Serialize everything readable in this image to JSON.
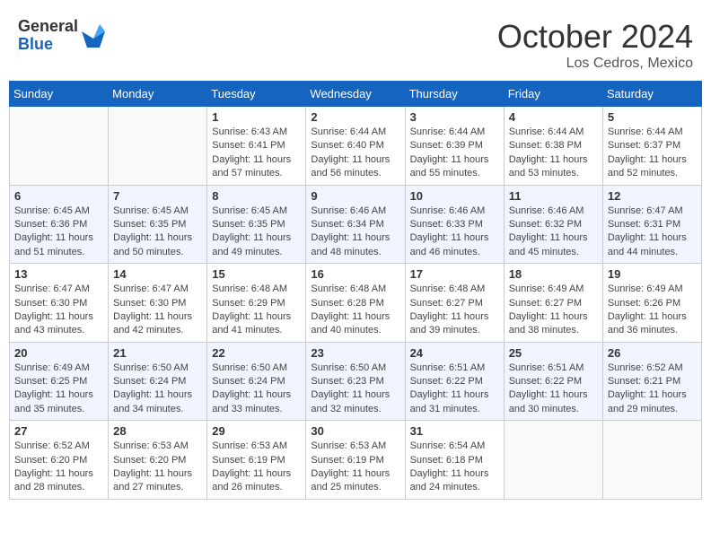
{
  "header": {
    "logo_general": "General",
    "logo_blue": "Blue",
    "month_title": "October 2024",
    "location": "Los Cedros, Mexico"
  },
  "weekdays": [
    "Sunday",
    "Monday",
    "Tuesday",
    "Wednesday",
    "Thursday",
    "Friday",
    "Saturday"
  ],
  "weeks": [
    [
      {
        "day": "",
        "sunrise": "",
        "sunset": "",
        "daylight": ""
      },
      {
        "day": "",
        "sunrise": "",
        "sunset": "",
        "daylight": ""
      },
      {
        "day": "1",
        "sunrise": "Sunrise: 6:43 AM",
        "sunset": "Sunset: 6:41 PM",
        "daylight": "Daylight: 11 hours and 57 minutes."
      },
      {
        "day": "2",
        "sunrise": "Sunrise: 6:44 AM",
        "sunset": "Sunset: 6:40 PM",
        "daylight": "Daylight: 11 hours and 56 minutes."
      },
      {
        "day": "3",
        "sunrise": "Sunrise: 6:44 AM",
        "sunset": "Sunset: 6:39 PM",
        "daylight": "Daylight: 11 hours and 55 minutes."
      },
      {
        "day": "4",
        "sunrise": "Sunrise: 6:44 AM",
        "sunset": "Sunset: 6:38 PM",
        "daylight": "Daylight: 11 hours and 53 minutes."
      },
      {
        "day": "5",
        "sunrise": "Sunrise: 6:44 AM",
        "sunset": "Sunset: 6:37 PM",
        "daylight": "Daylight: 11 hours and 52 minutes."
      }
    ],
    [
      {
        "day": "6",
        "sunrise": "Sunrise: 6:45 AM",
        "sunset": "Sunset: 6:36 PM",
        "daylight": "Daylight: 11 hours and 51 minutes."
      },
      {
        "day": "7",
        "sunrise": "Sunrise: 6:45 AM",
        "sunset": "Sunset: 6:35 PM",
        "daylight": "Daylight: 11 hours and 50 minutes."
      },
      {
        "day": "8",
        "sunrise": "Sunrise: 6:45 AM",
        "sunset": "Sunset: 6:35 PM",
        "daylight": "Daylight: 11 hours and 49 minutes."
      },
      {
        "day": "9",
        "sunrise": "Sunrise: 6:46 AM",
        "sunset": "Sunset: 6:34 PM",
        "daylight": "Daylight: 11 hours and 48 minutes."
      },
      {
        "day": "10",
        "sunrise": "Sunrise: 6:46 AM",
        "sunset": "Sunset: 6:33 PM",
        "daylight": "Daylight: 11 hours and 46 minutes."
      },
      {
        "day": "11",
        "sunrise": "Sunrise: 6:46 AM",
        "sunset": "Sunset: 6:32 PM",
        "daylight": "Daylight: 11 hours and 45 minutes."
      },
      {
        "day": "12",
        "sunrise": "Sunrise: 6:47 AM",
        "sunset": "Sunset: 6:31 PM",
        "daylight": "Daylight: 11 hours and 44 minutes."
      }
    ],
    [
      {
        "day": "13",
        "sunrise": "Sunrise: 6:47 AM",
        "sunset": "Sunset: 6:30 PM",
        "daylight": "Daylight: 11 hours and 43 minutes."
      },
      {
        "day": "14",
        "sunrise": "Sunrise: 6:47 AM",
        "sunset": "Sunset: 6:30 PM",
        "daylight": "Daylight: 11 hours and 42 minutes."
      },
      {
        "day": "15",
        "sunrise": "Sunrise: 6:48 AM",
        "sunset": "Sunset: 6:29 PM",
        "daylight": "Daylight: 11 hours and 41 minutes."
      },
      {
        "day": "16",
        "sunrise": "Sunrise: 6:48 AM",
        "sunset": "Sunset: 6:28 PM",
        "daylight": "Daylight: 11 hours and 40 minutes."
      },
      {
        "day": "17",
        "sunrise": "Sunrise: 6:48 AM",
        "sunset": "Sunset: 6:27 PM",
        "daylight": "Daylight: 11 hours and 39 minutes."
      },
      {
        "day": "18",
        "sunrise": "Sunrise: 6:49 AM",
        "sunset": "Sunset: 6:27 PM",
        "daylight": "Daylight: 11 hours and 38 minutes."
      },
      {
        "day": "19",
        "sunrise": "Sunrise: 6:49 AM",
        "sunset": "Sunset: 6:26 PM",
        "daylight": "Daylight: 11 hours and 36 minutes."
      }
    ],
    [
      {
        "day": "20",
        "sunrise": "Sunrise: 6:49 AM",
        "sunset": "Sunset: 6:25 PM",
        "daylight": "Daylight: 11 hours and 35 minutes."
      },
      {
        "day": "21",
        "sunrise": "Sunrise: 6:50 AM",
        "sunset": "Sunset: 6:24 PM",
        "daylight": "Daylight: 11 hours and 34 minutes."
      },
      {
        "day": "22",
        "sunrise": "Sunrise: 6:50 AM",
        "sunset": "Sunset: 6:24 PM",
        "daylight": "Daylight: 11 hours and 33 minutes."
      },
      {
        "day": "23",
        "sunrise": "Sunrise: 6:50 AM",
        "sunset": "Sunset: 6:23 PM",
        "daylight": "Daylight: 11 hours and 32 minutes."
      },
      {
        "day": "24",
        "sunrise": "Sunrise: 6:51 AM",
        "sunset": "Sunset: 6:22 PM",
        "daylight": "Daylight: 11 hours and 31 minutes."
      },
      {
        "day": "25",
        "sunrise": "Sunrise: 6:51 AM",
        "sunset": "Sunset: 6:22 PM",
        "daylight": "Daylight: 11 hours and 30 minutes."
      },
      {
        "day": "26",
        "sunrise": "Sunrise: 6:52 AM",
        "sunset": "Sunset: 6:21 PM",
        "daylight": "Daylight: 11 hours and 29 minutes."
      }
    ],
    [
      {
        "day": "27",
        "sunrise": "Sunrise: 6:52 AM",
        "sunset": "Sunset: 6:20 PM",
        "daylight": "Daylight: 11 hours and 28 minutes."
      },
      {
        "day": "28",
        "sunrise": "Sunrise: 6:53 AM",
        "sunset": "Sunset: 6:20 PM",
        "daylight": "Daylight: 11 hours and 27 minutes."
      },
      {
        "day": "29",
        "sunrise": "Sunrise: 6:53 AM",
        "sunset": "Sunset: 6:19 PM",
        "daylight": "Daylight: 11 hours and 26 minutes."
      },
      {
        "day": "30",
        "sunrise": "Sunrise: 6:53 AM",
        "sunset": "Sunset: 6:19 PM",
        "daylight": "Daylight: 11 hours and 25 minutes."
      },
      {
        "day": "31",
        "sunrise": "Sunrise: 6:54 AM",
        "sunset": "Sunset: 6:18 PM",
        "daylight": "Daylight: 11 hours and 24 minutes."
      },
      {
        "day": "",
        "sunrise": "",
        "sunset": "",
        "daylight": ""
      },
      {
        "day": "",
        "sunrise": "",
        "sunset": "",
        "daylight": ""
      }
    ]
  ]
}
